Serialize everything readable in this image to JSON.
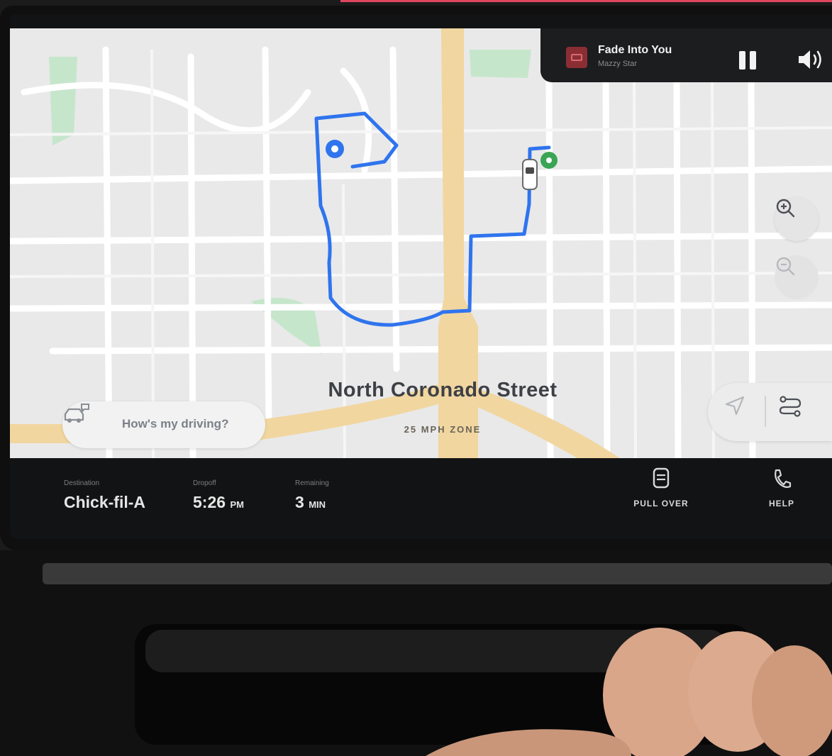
{
  "media": {
    "title": "Fade Into You",
    "artist": "Mazzy Star",
    "controls": {
      "pause_icon": "pause-icon",
      "volume_icon": "volume-icon",
      "album_art_icon": "album-art-icon"
    }
  },
  "map": {
    "street_name": "North Coronado Street",
    "speed_zone": "25 MPH ZONE",
    "feedback_prompt": "How's my driving?",
    "controls": {
      "zoom_in_icon": "zoom-in-icon",
      "zoom_out_icon": "zoom-out-icon",
      "recenter_icon": "navigation-arrow-icon",
      "route_icon": "route-overview-icon"
    },
    "colors": {
      "route": "#2f74ee",
      "highway": "#f1d6a0",
      "park": "#bfe4c6",
      "origin_pin": "#3aa555",
      "destination_pin": "#2f74ee"
    }
  },
  "trip": {
    "destination_label": "Destination",
    "destination": "Chick-fil-A",
    "dropoff_label": "Dropoff",
    "dropoff_time": "5:26",
    "dropoff_period": "PM",
    "remaining_label": "Remaining",
    "remaining_value": "3",
    "remaining_unit": "MIN",
    "pull_over_label": "PULL OVER",
    "help_label": "HELP"
  }
}
